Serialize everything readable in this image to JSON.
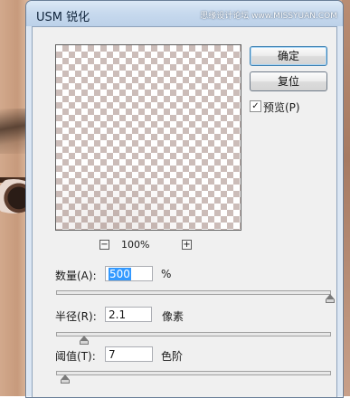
{
  "window": {
    "title": "USM 锐化",
    "watermark": "思缘设计论坛  www.MISSYUAN.COM"
  },
  "preview": {
    "zoom_out": "−",
    "zoom_in": "+",
    "zoom_level": "100%"
  },
  "buttons": {
    "ok": "确定",
    "reset": "复位"
  },
  "preview_checkbox": {
    "label": "预览(P)",
    "checked": true,
    "check_glyph": "✓"
  },
  "params": {
    "amount": {
      "label": "数量(A):",
      "value": "500",
      "unit": "%",
      "level": 1.0
    },
    "radius": {
      "label": "半径(R):",
      "value": "2.1",
      "unit": "像素",
      "level": 0.1
    },
    "threshold": {
      "label": "阈值(T):",
      "value": "7",
      "unit": "色阶",
      "level": 0.03
    }
  }
}
